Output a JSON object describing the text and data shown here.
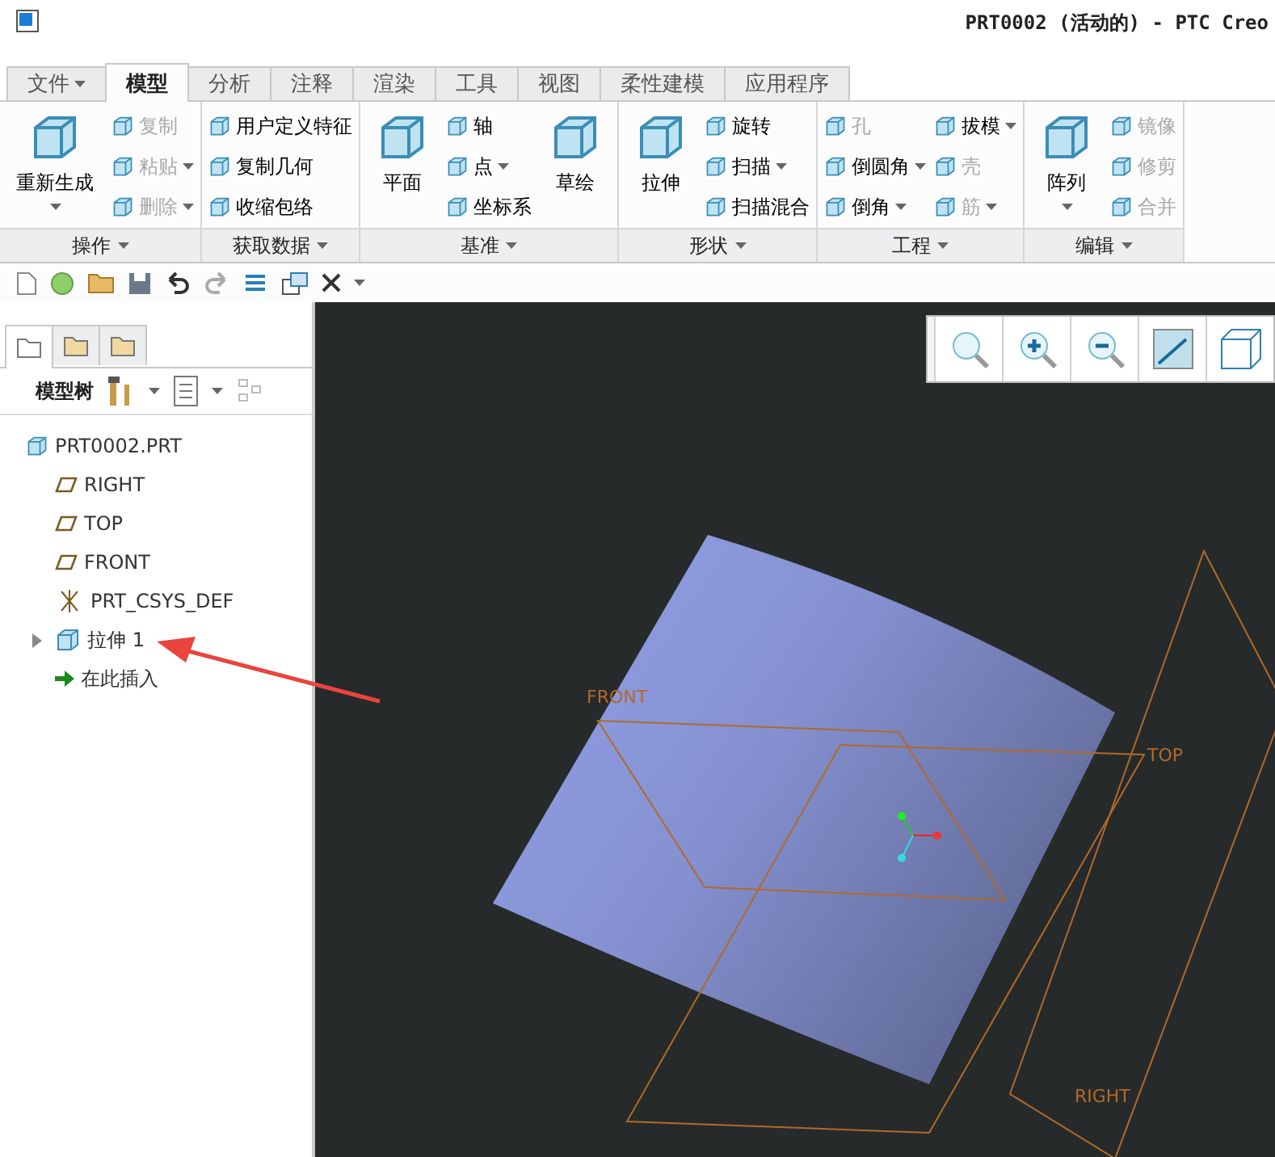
{
  "window": {
    "title": "PRT0002 (活动的) - PTC Creo"
  },
  "tabs": [
    {
      "label": "文件",
      "selected": false,
      "dropdown": true
    },
    {
      "label": "模型",
      "selected": true,
      "dropdown": false
    },
    {
      "label": "分析",
      "selected": false,
      "dropdown": false
    },
    {
      "label": "注释",
      "selected": false,
      "dropdown": false
    },
    {
      "label": "渲染",
      "selected": false,
      "dropdown": false
    },
    {
      "label": "工具",
      "selected": false,
      "dropdown": false
    },
    {
      "label": "视图",
      "selected": false,
      "dropdown": false
    },
    {
      "label": "柔性建模",
      "selected": false,
      "dropdown": false
    },
    {
      "label": "应用程序",
      "selected": false,
      "dropdown": false
    }
  ],
  "ribbon": {
    "groups": [
      {
        "label": "操作",
        "columns": [
          {
            "kind": "big",
            "label": "重新生成",
            "dropdown": true,
            "disabled": false
          },
          {
            "kind": "stack",
            "items": [
              {
                "label": "复制",
                "dropdown": false,
                "disabled": true
              },
              {
                "label": "粘贴",
                "dropdown": true,
                "disabled": true
              },
              {
                "label": "删除",
                "dropdown": true,
                "disabled": true
              }
            ]
          }
        ]
      },
      {
        "label": "获取数据",
        "columns": [
          {
            "kind": "stack",
            "items": [
              {
                "label": "用户定义特征",
                "dropdown": false,
                "disabled": false
              },
              {
                "label": "复制几何",
                "dropdown": false,
                "disabled": false
              },
              {
                "label": "收缩包络",
                "dropdown": false,
                "disabled": false
              }
            ]
          }
        ]
      },
      {
        "label": "基准",
        "columns": [
          {
            "kind": "big",
            "label": "平面",
            "dropdown": false,
            "disabled": false
          },
          {
            "kind": "stack",
            "items": [
              {
                "label": "轴",
                "dropdown": false,
                "disabled": false
              },
              {
                "label": "点",
                "dropdown": true,
                "disabled": false
              },
              {
                "label": "坐标系",
                "dropdown": false,
                "disabled": false
              }
            ]
          },
          {
            "kind": "big",
            "label": "草绘",
            "dropdown": false,
            "disabled": false
          }
        ]
      },
      {
        "label": "形状",
        "columns": [
          {
            "kind": "big",
            "label": "拉伸",
            "dropdown": false,
            "disabled": false
          },
          {
            "kind": "stack",
            "items": [
              {
                "label": "旋转",
                "dropdown": false,
                "disabled": false
              },
              {
                "label": "扫描",
                "dropdown": true,
                "disabled": false
              },
              {
                "label": "扫描混合",
                "dropdown": false,
                "disabled": false
              }
            ]
          }
        ]
      },
      {
        "label": "工程",
        "columns": [
          {
            "kind": "stack",
            "items": [
              {
                "label": "孔",
                "dropdown": false,
                "disabled": true
              },
              {
                "label": "倒圆角",
                "dropdown": true,
                "disabled": false
              },
              {
                "label": "倒角",
                "dropdown": true,
                "disabled": false
              }
            ]
          },
          {
            "kind": "stack",
            "items": [
              {
                "label": "拔模",
                "dropdown": true,
                "disabled": false
              },
              {
                "label": "壳",
                "dropdown": false,
                "disabled": true
              },
              {
                "label": "筋",
                "dropdown": true,
                "disabled": true
              }
            ]
          }
        ]
      },
      {
        "label": "编辑",
        "columns": [
          {
            "kind": "big",
            "label": "阵列",
            "dropdown": true,
            "disabled": false
          },
          {
            "kind": "stack",
            "items": [
              {
                "label": "镜像",
                "dropdown": false,
                "disabled": true
              },
              {
                "label": "修剪",
                "dropdown": false,
                "disabled": true
              },
              {
                "label": "合并",
                "dropdown": false,
                "disabled": true
              }
            ]
          }
        ]
      }
    ]
  },
  "panel_tabs": [
    {
      "selected": true
    },
    {
      "selected": false
    },
    {
      "selected": false
    }
  ],
  "model_tree": {
    "title": "模型树",
    "items": [
      {
        "kind": "part",
        "label": "PRT0002.PRT",
        "expandable": false
      },
      {
        "kind": "plane",
        "label": "RIGHT",
        "expandable": false
      },
      {
        "kind": "plane",
        "label": "TOP",
        "expandable": false
      },
      {
        "kind": "plane",
        "label": "FRONT",
        "expandable": false
      },
      {
        "kind": "csys",
        "label": "PRT_CSYS_DEF",
        "expandable": false
      },
      {
        "kind": "feature",
        "label": "拉伸 1",
        "expandable": true
      },
      {
        "kind": "insert",
        "label": "在此插入",
        "expandable": false
      }
    ]
  },
  "viewport": {
    "datum_labels": [
      "FRONT",
      "TOP",
      "RIGHT"
    ]
  }
}
